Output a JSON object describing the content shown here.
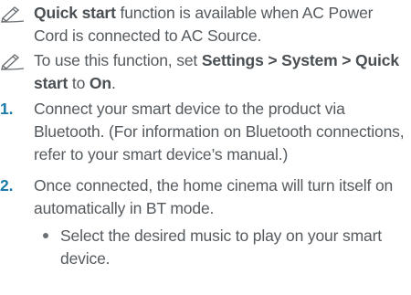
{
  "note1": {
    "icon": "pencil-note-icon",
    "bold": "Quick start",
    "text": " function is available when AC Power Cord is connected to AC Source."
  },
  "note2": {
    "icon": "pencil-note-icon",
    "text1": "To use this function, set ",
    "path": "Settings > System > Quick start",
    "text2": " to ",
    "value": "On",
    "text3": "."
  },
  "steps": [
    {
      "num": "1.",
      "text": "Connect your smart device to the product via Bluetooth. (For information on Bluetooth connections, refer to your smart device’s manual.)"
    },
    {
      "num": "2.",
      "text": "Once connected, the home cinema will turn itself on automatically in BT mode.",
      "bullet": "Select the desired music to play on your smart device."
    }
  ]
}
